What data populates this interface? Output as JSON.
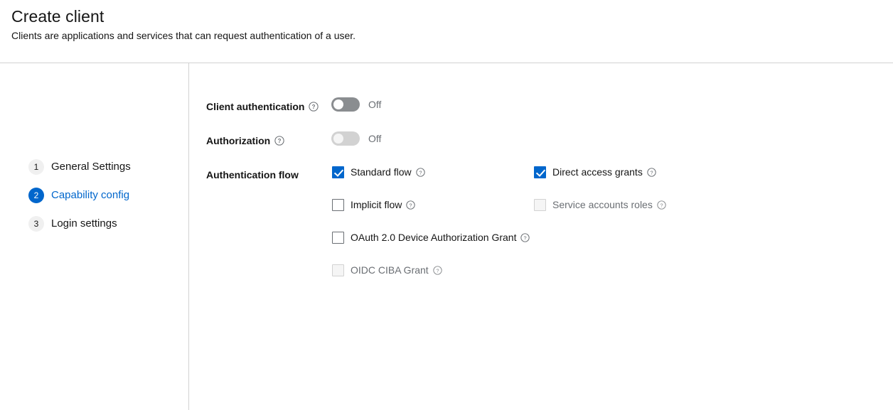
{
  "header": {
    "title": "Create client",
    "subtitle": "Clients are applications and services that can request authentication of a user."
  },
  "wizard": {
    "steps": [
      {
        "number": "1",
        "label": "General Settings",
        "active": false
      },
      {
        "number": "2",
        "label": "Capability config",
        "active": true
      },
      {
        "number": "3",
        "label": "Login settings",
        "active": false
      }
    ]
  },
  "form": {
    "client_authentication": {
      "label": "Client authentication",
      "help_icon": "help-circle-icon",
      "state_label": "Off",
      "checked": false,
      "disabled": false
    },
    "authorization": {
      "label": "Authorization",
      "help_icon": "help-circle-icon",
      "state_label": "Off",
      "checked": false,
      "disabled": true
    },
    "authentication_flow": {
      "label": "Authentication flow",
      "options": [
        {
          "label": "Standard flow",
          "checked": true,
          "disabled": false,
          "help_icon": "help-circle-icon"
        },
        {
          "label": "Direct access grants",
          "checked": true,
          "disabled": false,
          "help_icon": "help-circle-icon"
        },
        {
          "label": "Implicit flow",
          "checked": false,
          "disabled": false,
          "help_icon": "help-circle-icon"
        },
        {
          "label": "Service accounts roles",
          "checked": false,
          "disabled": true,
          "help_icon": "help-circle-icon"
        },
        {
          "label": "OAuth 2.0 Device Authorization Grant",
          "checked": false,
          "disabled": false,
          "help_icon": "help-circle-icon"
        },
        {
          "label": "OIDC CIBA Grant",
          "checked": false,
          "disabled": true,
          "help_icon": "help-circle-icon"
        }
      ]
    }
  },
  "colors": {
    "accent": "#0066cc",
    "text": "#151515",
    "muted": "#6a6e73",
    "border": "#d2d2d2",
    "switch_on_track": "#8a8d90",
    "switch_off_track": "#d2d2d2"
  }
}
